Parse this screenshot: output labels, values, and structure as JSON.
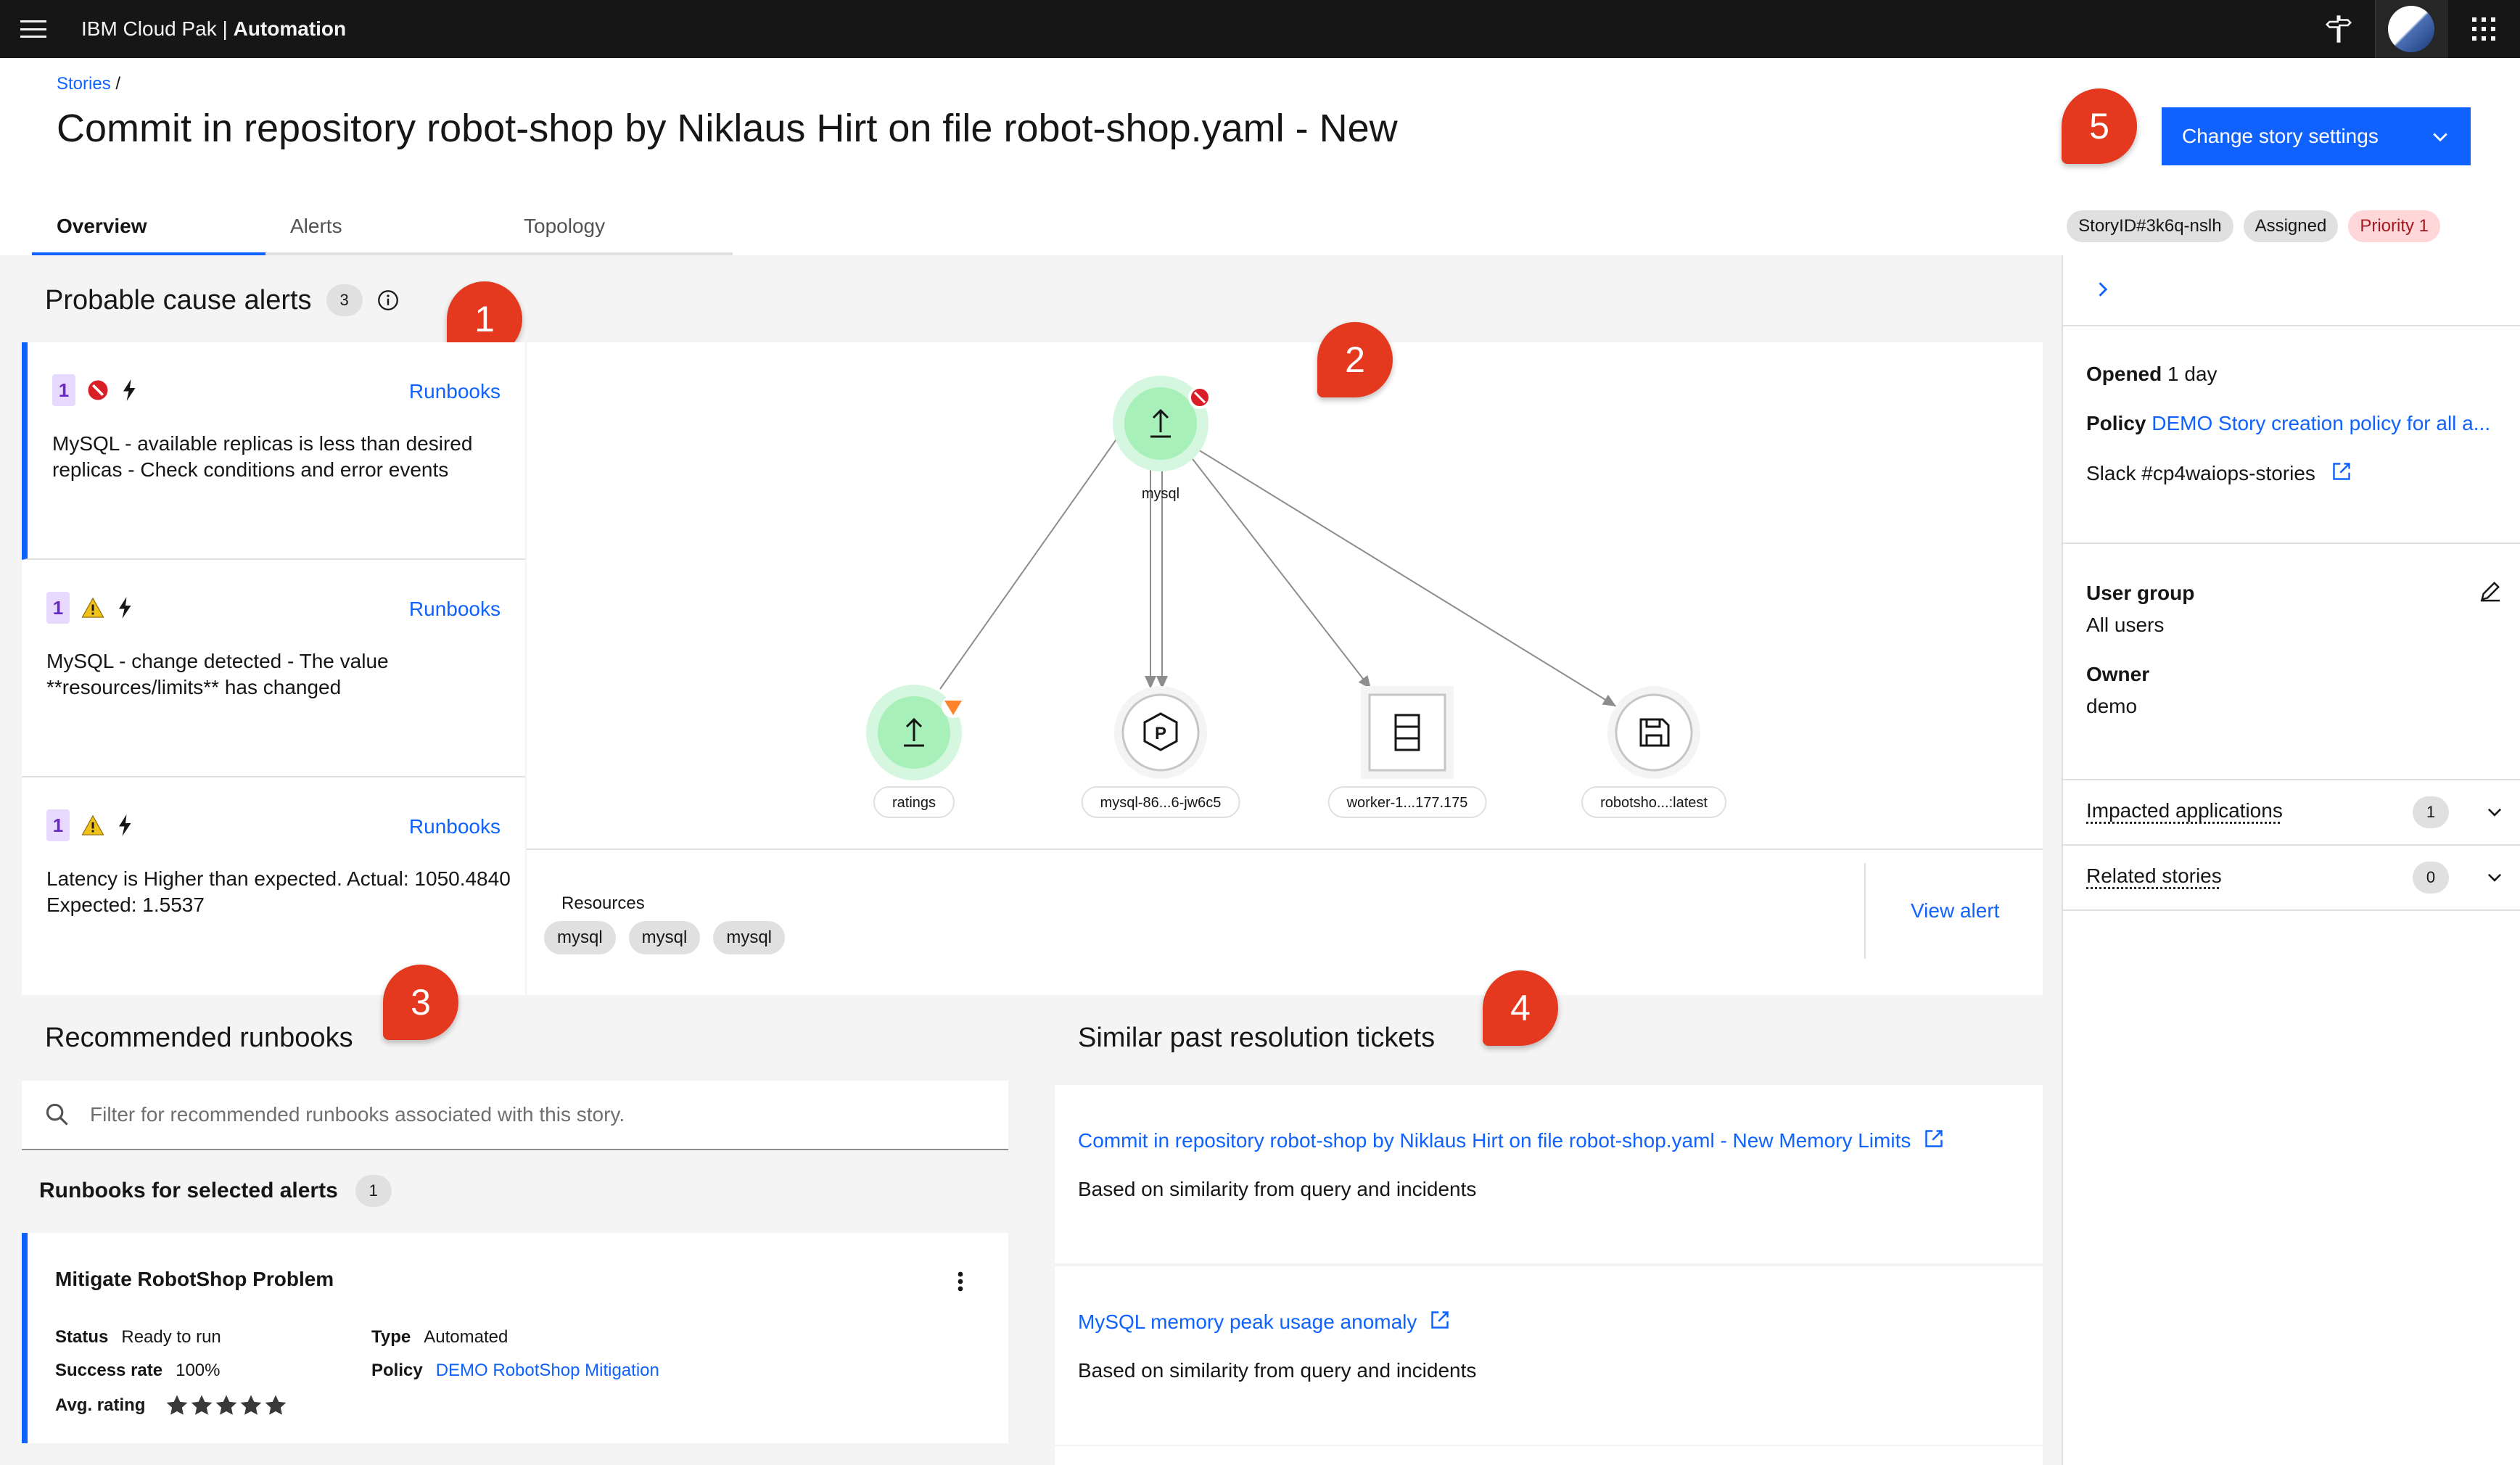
{
  "topbar": {
    "brand_prefix": "IBM Cloud Pak",
    "brand_separator": "|",
    "brand_product": "Automation"
  },
  "breadcrumb": {
    "item": "Stories",
    "separator": "/"
  },
  "page_title": "Commit in repository robot-shop by Niklaus Hirt on file robot-shop.yaml - New",
  "change_settings_label": "Change story settings",
  "callouts": [
    "1",
    "2",
    "3",
    "4",
    "5"
  ],
  "tabs": [
    {
      "label": "Overview",
      "active": true
    },
    {
      "label": "Alerts",
      "active": false
    },
    {
      "label": "Topology",
      "active": false
    }
  ],
  "tags": {
    "story_id": "StoryID#3k6q-nslh",
    "status": "Assigned",
    "priority": "Priority 1"
  },
  "probable_cause": {
    "title": "Probable cause alerts",
    "count": "3",
    "alerts": [
      {
        "priority": "1",
        "severity": "critical",
        "runbooks_label": "Runbooks",
        "text": "MySQL - available replicas is less than desired replicas - Check conditions and error events"
      },
      {
        "priority": "1",
        "severity": "warning",
        "runbooks_label": "Runbooks",
        "text": "MySQL - change detected - The value **resources/limits** has changed"
      },
      {
        "priority": "1",
        "severity": "warning",
        "runbooks_label": "Runbooks",
        "text": "Latency is Higher than expected. Actual: 1050.4840 Expected: 1.5537"
      }
    ]
  },
  "topology": {
    "nodes": {
      "mysql": "mysql",
      "ratings": "ratings",
      "pod": "mysql-86...6-jw6c5",
      "worker": "worker-1...177.175",
      "image": "robotsho...:latest"
    },
    "resources_label": "Resources",
    "resources": [
      "mysql",
      "mysql",
      "mysql"
    ],
    "view_alert_label": "View alert"
  },
  "runbooks": {
    "title": "Recommended runbooks",
    "search_placeholder": "Filter for recommended runbooks associated with this story.",
    "selected_title": "Runbooks for selected alerts",
    "selected_count": "1",
    "card": {
      "name": "Mitigate RobotShop Problem",
      "status_label": "Status",
      "status": "Ready to run",
      "success_label": "Success rate",
      "success": "100%",
      "rating_label": "Avg. rating",
      "rating_stars": 5,
      "type_label": "Type",
      "type": "Automated",
      "policy_label": "Policy",
      "policy": "DEMO RobotShop Mitigation"
    }
  },
  "tickets": {
    "title": "Similar past resolution tickets",
    "items": [
      {
        "title": "Commit in repository robot-shop by Niklaus Hirt on file robot-shop.yaml - New Memory Limits",
        "subtitle": "Based on similarity from query and incidents"
      },
      {
        "title": "MySQL memory peak usage anomaly",
        "subtitle": "Based on similarity from query and incidents"
      }
    ]
  },
  "side_panel": {
    "opened_label": "Opened",
    "opened_value": "1 day",
    "policy_label": "Policy",
    "policy_value": "DEMO Story creation policy for all a...",
    "slack_link": "Slack #cp4waiops-stories",
    "user_group_label": "User group",
    "user_group_value": "All users",
    "owner_label": "Owner",
    "owner_value": "demo",
    "impacted_label": "Impacted applications",
    "impacted_count": "1",
    "related_label": "Related stories",
    "related_count": "0"
  },
  "colors": {
    "primary": "#0f62fe",
    "callout": "#e5391f",
    "critical": "#da1e28",
    "warning": "#f1c21b",
    "node_green": "#a7f0ba"
  }
}
